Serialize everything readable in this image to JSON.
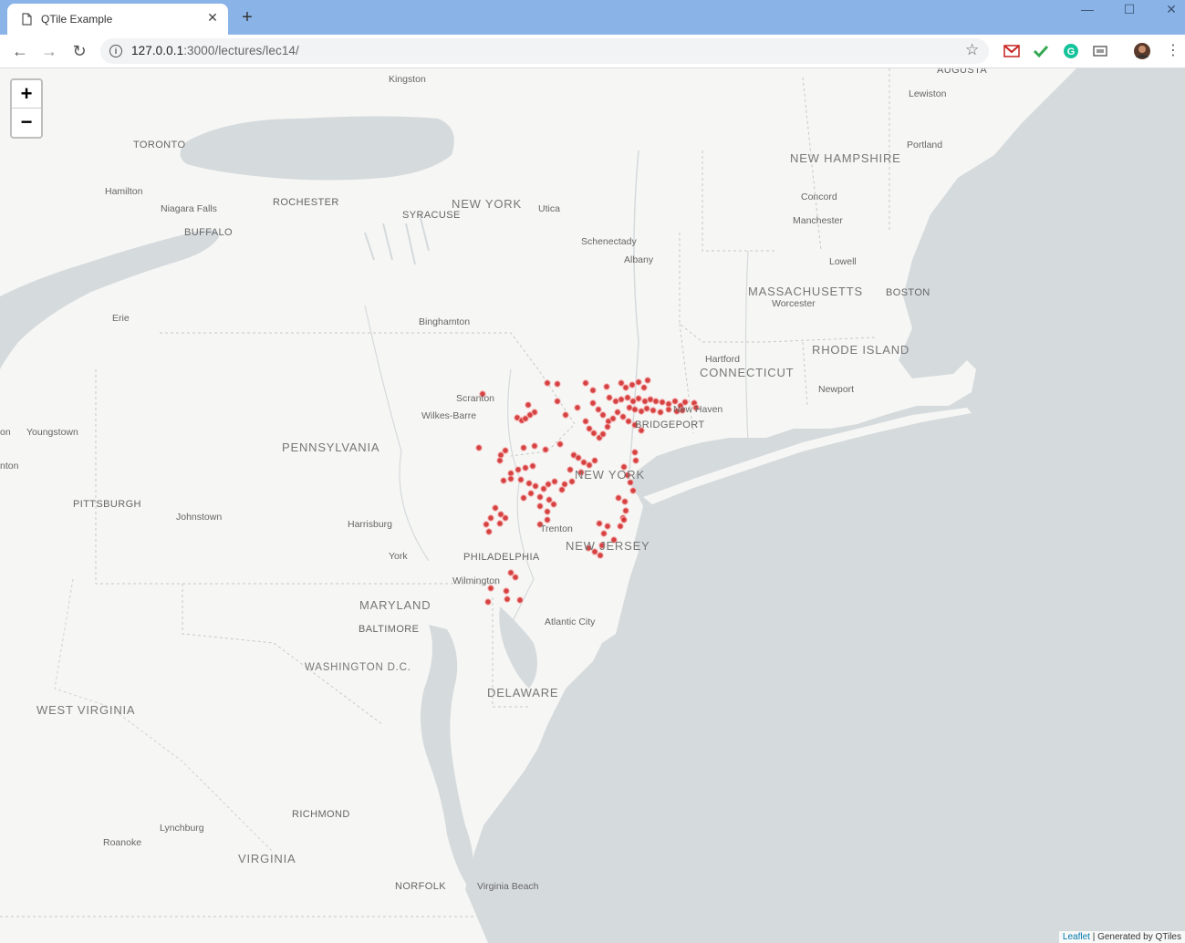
{
  "browser": {
    "tab_title": "QTile Example",
    "tab_close": "✕",
    "new_tab": "+",
    "url_host": "127.0.0.1",
    "url_rest": ":3000/lectures/lec14/",
    "info_icon": "i"
  },
  "map": {
    "zoom_in": "+",
    "zoom_out": "−",
    "attribution_link": "Leaflet",
    "attribution_text": " | Generated by QTiles",
    "marker_color": "#d32f2f",
    "regions": {
      "new_hampshire": "NEW HAMPSHIRE",
      "new_york": "NEW YORK",
      "massachusetts": "MASSACHUSETTS",
      "rhode_island": "RHODE ISLAND",
      "connecticut": "CONNECTICUT",
      "pennsylvania": "PENNSYLVANIA",
      "new_jersey": "NEW JERSEY",
      "maryland": "MARYLAND",
      "delaware": "DELAWARE",
      "west_virginia": "WEST VIRGINIA",
      "virginia": "VIRGINIA",
      "washington": "WASHINGTON D.C."
    },
    "cities": {
      "kingston": "Kingston",
      "augusta": "AUGUSTA",
      "lewiston": "Lewiston",
      "toronto": "TORONTO",
      "portland": "Portland",
      "hamilton": "Hamilton",
      "niagara": "Niagara Falls",
      "rochester": "ROCHESTER",
      "syracuse": "SYRACUSE",
      "utica": "Utica",
      "concord": "Concord",
      "buffalo": "BUFFALO",
      "manchester": "Manchester",
      "schenectady": "Schenectady",
      "albany": "Albany",
      "lowell": "Lowell",
      "boston": "BOSTON",
      "worcester": "Worcester",
      "erie": "Erie",
      "binghamton": "Binghamton",
      "hartford": "Hartford",
      "newport": "Newport",
      "scranton": "Scranton",
      "wilkes_barre": "Wilkes-Barre",
      "new_haven": "New Haven",
      "bridgeport": "BRIDGEPORT",
      "youngstown": "Youngstown",
      "pittsburgh": "PITTSBURGH",
      "johnstown": "Johnstown",
      "harrisburg": "Harrisburg",
      "trenton": "Trenton",
      "york": "York",
      "philadelphia": "PHILADELPHIA",
      "wilmington": "Wilmington",
      "baltimore": "BALTIMORE",
      "atlantic_city": "Atlantic City",
      "new_york_city": "NEW YORK",
      "richmond": "RICHMOND",
      "lynchburg": "Lynchburg",
      "roanoke": "Roanoke",
      "norfolk": "NORFOLK",
      "virginia_beach": "Virginia Beach",
      "canton_partial": "on",
      "partial_2": "nton"
    }
  }
}
